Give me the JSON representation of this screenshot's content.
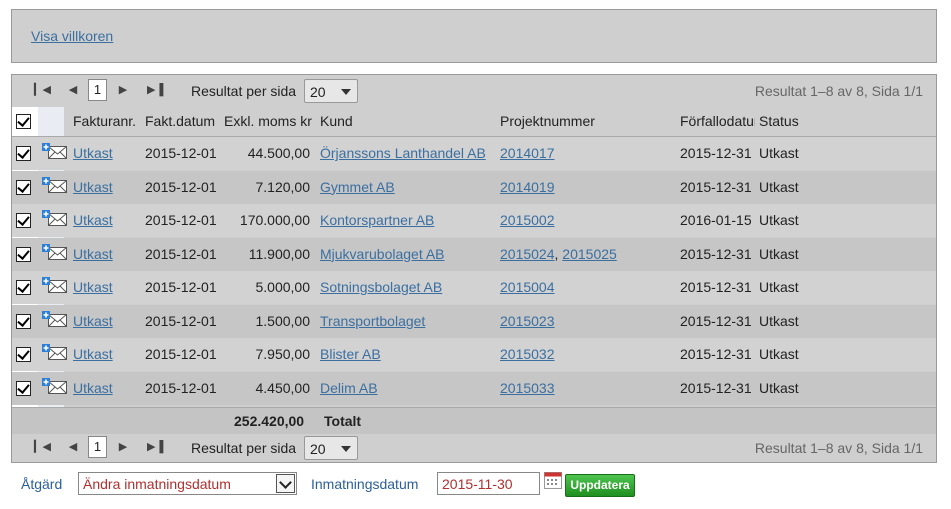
{
  "terms_link": "Visa villkoren",
  "pager": {
    "current_page": "1",
    "per_page_label": "Resultat per sida",
    "per_page_value": "20",
    "result_info": "Resultat 1–8 av 8, Sida 1/1"
  },
  "columns": {
    "invoice_no": "Fakturanr.",
    "invoice_date": "Fakt.datum",
    "excl_vat": "Exkl. moms kr",
    "customer": "Kund",
    "project_no": "Projektnummer",
    "due_date": "Förfallodatum",
    "status": "Status"
  },
  "rows": [
    {
      "invoice": "Utkast",
      "date": "2015-12-01",
      "amount": "44.500,00",
      "customer": "Örjanssons Lanthandel AB",
      "project1": "2014017",
      "project2": "",
      "due": "2015-12-31",
      "status": "Utkast"
    },
    {
      "invoice": "Utkast",
      "date": "2015-12-01",
      "amount": "7.120,00",
      "customer": "Gymmet AB",
      "project1": "2014019",
      "project2": "",
      "due": "2015-12-31",
      "status": "Utkast"
    },
    {
      "invoice": "Utkast",
      "date": "2015-12-01",
      "amount": "170.000,00",
      "customer": "Kontorspartner AB",
      "project1": "2015002",
      "project2": "",
      "due": "2016-01-15",
      "status": "Utkast"
    },
    {
      "invoice": "Utkast",
      "date": "2015-12-01",
      "amount": "11.900,00",
      "customer": "Mjukvarubolaget AB",
      "project1": "2015024",
      "project2": "2015025",
      "due": "2015-12-31",
      "status": "Utkast"
    },
    {
      "invoice": "Utkast",
      "date": "2015-12-01",
      "amount": "5.000,00",
      "customer": "Sotningsbolaget AB",
      "project1": "2015004",
      "project2": "",
      "due": "2015-12-31",
      "status": "Utkast"
    },
    {
      "invoice": "Utkast",
      "date": "2015-12-01",
      "amount": "1.500,00",
      "customer": "Transportbolaget",
      "project1": "2015023",
      "project2": "",
      "due": "2015-12-31",
      "status": "Utkast"
    },
    {
      "invoice": "Utkast",
      "date": "2015-12-01",
      "amount": "7.950,00",
      "customer": "Blister AB",
      "project1": "2015032",
      "project2": "",
      "due": "2015-12-31",
      "status": "Utkast"
    },
    {
      "invoice": "Utkast",
      "date": "2015-12-01",
      "amount": "4.450,00",
      "customer": "Delim AB",
      "project1": "2015033",
      "project2": "",
      "due": "2015-12-31",
      "status": "Utkast"
    }
  ],
  "total": {
    "amount": "252.420,00",
    "label": "Totalt"
  },
  "action": {
    "label": "Åtgärd",
    "selected": "Ändra inmatningsdatum",
    "date_label": "Inmatningsdatum",
    "date_value": "2015-11-30",
    "update_button": "Uppdatera"
  },
  "colors": {
    "link": "#3b6fa0",
    "row_alt": "#c6c6c6",
    "row": "#d2d2d2",
    "update_button": "#2ea32e"
  }
}
